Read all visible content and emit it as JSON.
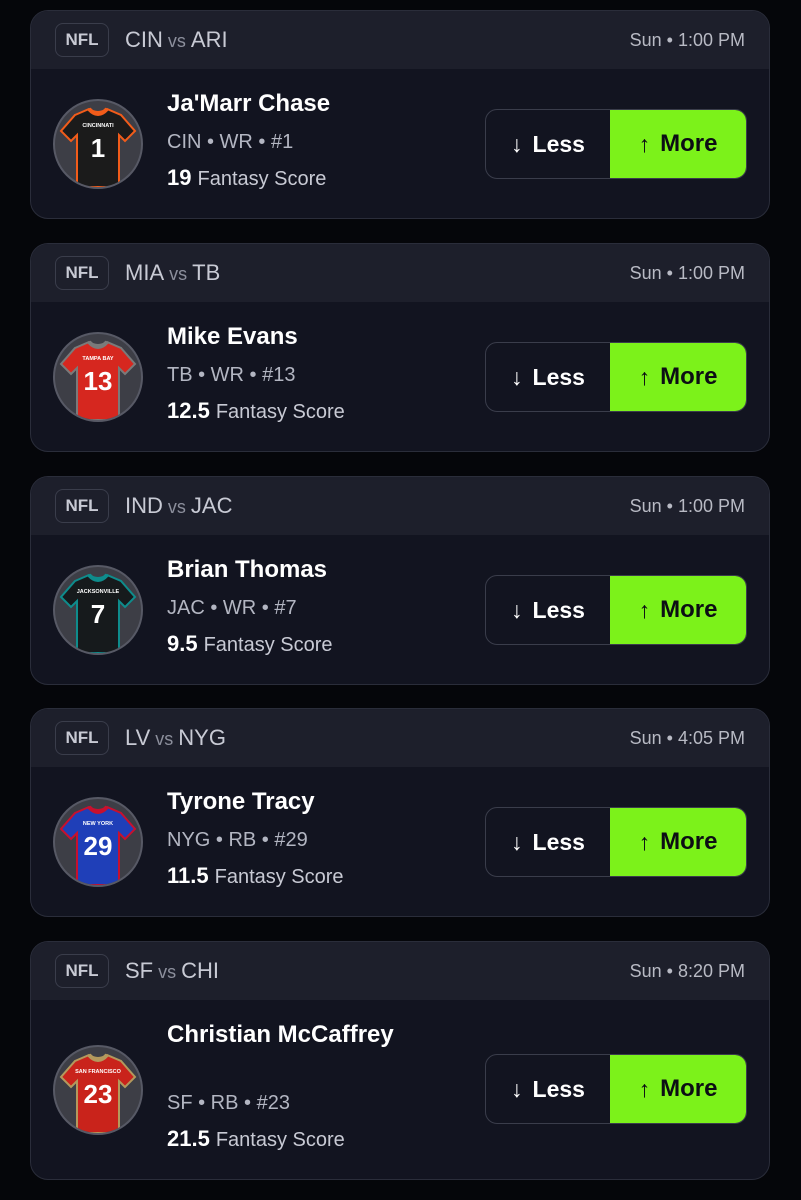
{
  "colors": {
    "accent": "#7cf21a",
    "card_bg": "#121420",
    "header_bg": "#1d1f2b",
    "page_bg": "#05060a"
  },
  "cards": [
    {
      "league": "NFL",
      "home": "CIN",
      "vs": "vs",
      "away": "ARI",
      "time": "Sun • 1:00 PM",
      "player": "Ja'Marr Chase",
      "meta": "CIN • WR • #1",
      "score": "19",
      "score_label": "Fantasy Score",
      "less_label": "Less",
      "more_label": "More",
      "less_icon": "arrow-down-icon",
      "more_icon": "arrow-up-icon",
      "jersey": {
        "text": "CINCINNATI",
        "number": "1",
        "color": "#1b1b1b",
        "accent": "#f25c1a",
        "num_color": "#ffffff"
      }
    },
    {
      "league": "NFL",
      "home": "MIA",
      "vs": "vs",
      "away": "TB",
      "time": "Sun • 1:00 PM",
      "player": "Mike Evans",
      "meta": "TB • WR • #13",
      "score": "12.5",
      "score_label": "Fantasy Score",
      "less_label": "Less",
      "more_label": "More",
      "less_icon": "arrow-down-icon",
      "more_icon": "arrow-up-icon",
      "jersey": {
        "text": "TAMPA BAY",
        "number": "13",
        "color": "#d6271f",
        "accent": "#7a7a7a",
        "num_color": "#ffffff"
      }
    },
    {
      "league": "NFL",
      "home": "IND",
      "vs": "vs",
      "away": "JAC",
      "time": "Sun • 1:00 PM",
      "player": "Brian Thomas",
      "meta": "JAC • WR • #7",
      "score": "9.5",
      "score_label": "Fantasy Score",
      "less_label": "Less",
      "more_label": "More",
      "less_icon": "arrow-down-icon",
      "more_icon": "arrow-up-icon",
      "jersey": {
        "text": "JACKSONVILLE",
        "number": "7",
        "color": "#161a1c",
        "accent": "#0e8c8c",
        "num_color": "#ffffff"
      }
    },
    {
      "league": "NFL",
      "home": "LV",
      "vs": "vs",
      "away": "NYG",
      "time": "Sun • 4:05 PM",
      "player": "Tyrone Tracy",
      "meta": "NYG • RB • #29",
      "score": "11.5",
      "score_label": "Fantasy Score",
      "less_label": "Less",
      "more_label": "More",
      "less_icon": "arrow-down-icon",
      "more_icon": "arrow-up-icon",
      "jersey": {
        "text": "NEW YORK",
        "number": "29",
        "color": "#1f3fb8",
        "accent": "#c8102e",
        "num_color": "#ffffff"
      }
    },
    {
      "league": "NFL",
      "home": "SF",
      "vs": "vs",
      "away": "CHI",
      "time": "Sun • 8:20 PM",
      "player": "Christian McCaffrey",
      "meta": "SF • RB • #23",
      "score": "21.5",
      "score_label": "Fantasy Score",
      "less_label": "Less",
      "more_label": "More",
      "less_icon": "arrow-down-icon",
      "more_icon": "arrow-up-icon",
      "jersey": {
        "text": "SAN FRANCISCO",
        "number": "23",
        "color": "#c9231b",
        "accent": "#b3995d",
        "num_color": "#ffffff"
      }
    }
  ]
}
